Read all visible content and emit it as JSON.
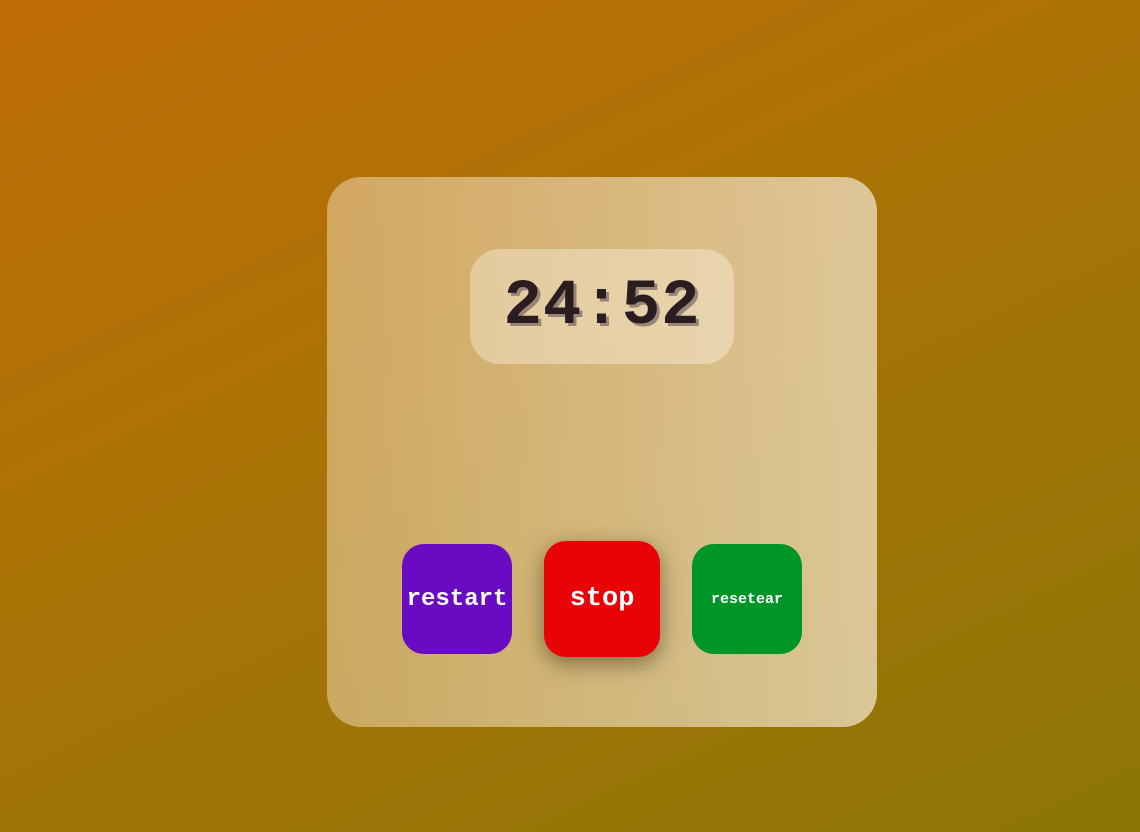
{
  "timer": {
    "display": "24:52"
  },
  "controls": {
    "restart_label": "restart",
    "stop_label": "stop",
    "reset_label": "resetear"
  },
  "colors": {
    "restart": "#6a0bc4",
    "stop": "#e70306",
    "reset": "#009529"
  }
}
